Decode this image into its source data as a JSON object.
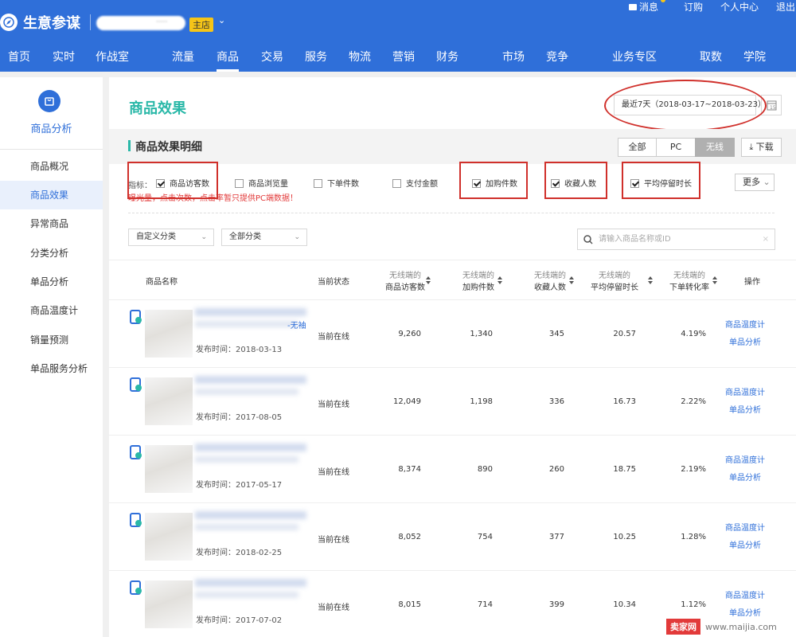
{
  "header": {
    "brand": "生意参谋",
    "shop_placeholder": "·····",
    "shop_badge": "主店",
    "links": [
      "消息",
      "订购",
      "个人中心",
      "退出"
    ],
    "nav": [
      "首页",
      "实时",
      "作战室",
      "流量",
      "商品",
      "交易",
      "服务",
      "物流",
      "营销",
      "财务",
      "市场",
      "竞争",
      "业务专区",
      "取数",
      "学院"
    ],
    "active_nav": "商品"
  },
  "sidebar": {
    "title": "商品分析",
    "items": [
      "商品概况",
      "商品效果",
      "异常商品",
      "分类分析",
      "单品分析",
      "商品温度计",
      "销量预测",
      "单品服务分析"
    ],
    "active_item": "商品效果"
  },
  "main": {
    "title": "商品效果",
    "date_range": "最近7天（2018-03-17~2018-03-23）",
    "section_title": "商品效果明细",
    "segments": [
      "全部",
      "PC",
      "无线"
    ],
    "active_segment": "无线",
    "download": "下载",
    "metrics_label": "指标：",
    "metrics": [
      {
        "label": "商品访客数",
        "checked": true
      },
      {
        "label": "商品浏览量",
        "checked": false
      },
      {
        "label": "下单件数",
        "checked": false
      },
      {
        "label": "支付金额",
        "checked": false
      },
      {
        "label": "加购件数",
        "checked": true
      },
      {
        "label": "收藏人数",
        "checked": true
      },
      {
        "label": "平均停留时长",
        "checked": true
      }
    ],
    "warning": "曝光量，点击次数，点击率暂只提供PC端数据！",
    "more": "更多",
    "filter_custom": "自定义分类",
    "filter_all": "全部分类",
    "search_placeholder": "请输入商品名称或ID"
  },
  "table": {
    "col_name": "商品名称",
    "col_status": "当前状态",
    "col_prefix": "无线端的",
    "col_visitors": "商品访客数",
    "col_cart": "加购件数",
    "col_fav": "收藏人数",
    "col_stay": "平均停留时长",
    "col_conv": "下单转化率",
    "col_op": "操作",
    "op_thermo": "商品温度计",
    "op_analysis": "单品分析",
    "pub_prefix": "发布时间：",
    "rows": [
      {
        "title_tail": "-无袖",
        "pub": "2018-03-13",
        "status": "当前在线",
        "visitors": "9,260",
        "cart": "1,340",
        "fav": "345",
        "stay": "20.57",
        "conv": "4.19%"
      },
      {
        "title_tail": "",
        "pub": "2017-08-05",
        "status": "当前在线",
        "visitors": "12,049",
        "cart": "1,198",
        "fav": "336",
        "stay": "16.73",
        "conv": "2.22%"
      },
      {
        "title_tail": "",
        "pub": "2017-05-17",
        "status": "当前在线",
        "visitors": "8,374",
        "cart": "890",
        "fav": "260",
        "stay": "18.75",
        "conv": "2.19%"
      },
      {
        "title_tail": "",
        "pub": "2018-02-25",
        "status": "当前在线",
        "visitors": "8,052",
        "cart": "754",
        "fav": "377",
        "stay": "10.25",
        "conv": "1.28%"
      },
      {
        "title_tail": "",
        "pub": "2017-07-02",
        "status": "当前在线",
        "visitors": "8,015",
        "cart": "714",
        "fav": "399",
        "stay": "10.34",
        "conv": "1.12%"
      }
    ]
  },
  "watermark": {
    "brand": "卖家网",
    "url": "www.maijia.com"
  },
  "colors": {
    "primary": "#2f6fd9",
    "teal": "#2ab8a8",
    "annotation_red": "#d0302b",
    "badge_yellow": "#f5c518"
  }
}
